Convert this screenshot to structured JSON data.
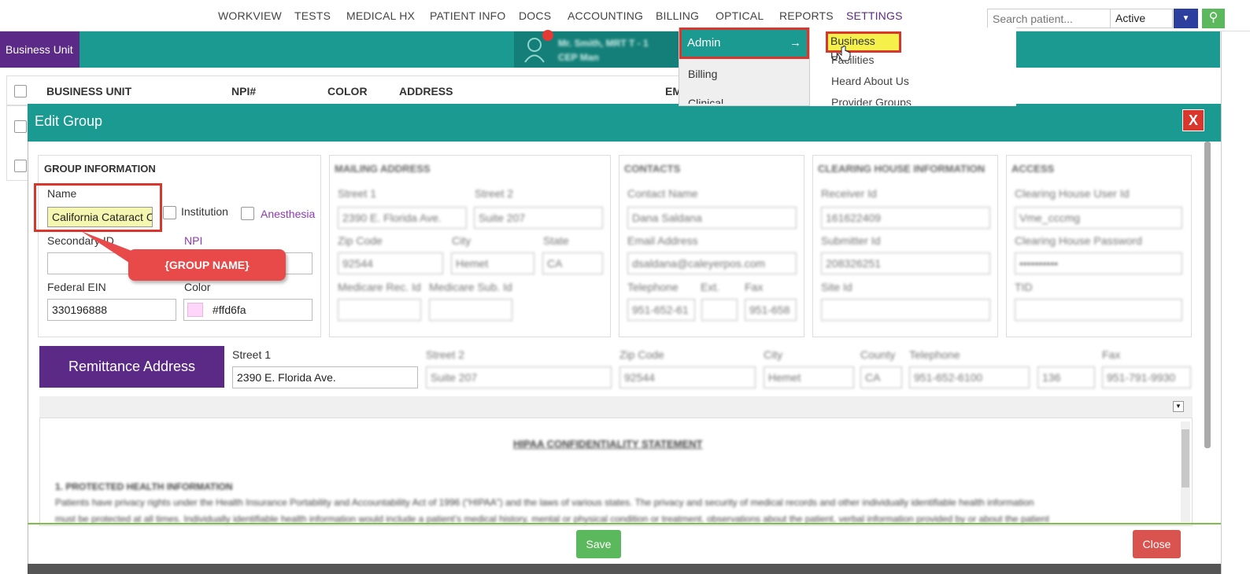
{
  "nav": {
    "items": [
      "WORKVIEW",
      "TESTS",
      "MEDICAL HX",
      "PATIENT INFO",
      "DOCS",
      "ACCOUNTING",
      "BILLING",
      "OPTICAL",
      "REPORTS",
      "SETTINGS"
    ],
    "active": "SETTINGS",
    "search_placeholder": "Search patient...",
    "status_value": "Active",
    "status_options": [
      "Active"
    ]
  },
  "page_tab": "Business Unit",
  "patient_badge": {
    "line1": "Mr. Smith, MRT T - 1",
    "line2": "CEP Man"
  },
  "settings_menu": {
    "left": [
      "Admin",
      "Billing",
      "Clinical"
    ],
    "right": [
      "Business Unit",
      "Facilities",
      "Heard About Us",
      "Provider Groups"
    ]
  },
  "table": {
    "headers": [
      "BUSINESS UNIT",
      "NPI#",
      "COLOR",
      "ADDRESS",
      "EM"
    ]
  },
  "modal": {
    "title": "Edit Group",
    "close_x": "X",
    "group_info": {
      "title": "GROUP INFORMATION",
      "name_label": "Name",
      "name_value": "California Cataract Consultants",
      "institution_label": "Institution",
      "anesthesia_label": "Anesthesia",
      "secondary_id_label": "Secondary ID",
      "npi_label": "NPI",
      "federal_ein_label": "Federal EIN",
      "federal_ein_value": "330196888",
      "color_label": "Color",
      "color_value": "#ffd6fa"
    },
    "callout": "{GROUP NAME}",
    "mailing": {
      "title": "MAILING ADDRESS",
      "street1_label": "Street 1",
      "street1": "2390 E. Florida Ave.",
      "street2_label": "Street 2",
      "street2": "Suite 207",
      "zip_label": "Zip Code",
      "zip": "92544",
      "city_label": "City",
      "city": "Hemet",
      "state_label": "State",
      "state": "CA",
      "mrid_label": "Medicare Rec. Id",
      "msid_label": "Medicare Sub. Id"
    },
    "contacts": {
      "title": "CONTACTS",
      "contact_label": "Contact Name",
      "contact": "Dana Saldana",
      "email_label": "Email Address",
      "email": "dsaldana@caleyerpos.com",
      "tel_label": "Telephone",
      "tel": "951-652-61",
      "ext_label": "Ext.",
      "fax_label": "Fax",
      "fax": "951-658"
    },
    "clearing": {
      "title": "CLEARING HOUSE INFORMATION",
      "receiver_label": "Receiver Id",
      "receiver": "161622409",
      "submitter_label": "Submitter Id",
      "submitter": "208326251",
      "site_label": "Site Id"
    },
    "access": {
      "title": "ACCESS",
      "user_label": "Clearing House User Id",
      "user": "Vme_cccmg",
      "pass_label": "Clearing House Password",
      "pass": "••••••••••",
      "tid_label": "TID"
    },
    "remittance": {
      "button": "Remittance Address",
      "street1_label": "Street 1",
      "street1": "2390 E. Florida Ave.",
      "street2_label": "Street 2",
      "street2": "Suite 207",
      "zip_label": "Zip Code",
      "zip": "92544",
      "city_label": "City",
      "city": "Hemet",
      "county_label": "County",
      "county": "CA",
      "tel_label": "Telephone",
      "tel": "951-652-6100",
      "ext": "136",
      "fax_label": "Fax",
      "fax": "951-791-9930"
    },
    "document": {
      "heading": "HIPAA CONFIDENTIALITY STATEMENT",
      "section": "1. PROTECTED HEALTH INFORMATION",
      "para1": "Patients have privacy rights under the Health Insurance Portability and Accountability Act of 1996 (“HIPAA”) and the laws of various states. The privacy and security of medical records and other individually identifiable health information",
      "para2": "must be protected at all times. Individually identifiable health information would include a patient’s medical history, mental or physical condition or treatment, observations about the patient, verbal information provided by or about the patient"
    },
    "save": "Save",
    "close": "Close"
  },
  "colors": {
    "teal": "#1a9a90",
    "purple": "#5b2a86",
    "highlight_red": "#d9362e",
    "name_fill": "#f5f7b0",
    "color_swatch": "#ffd6fa"
  }
}
